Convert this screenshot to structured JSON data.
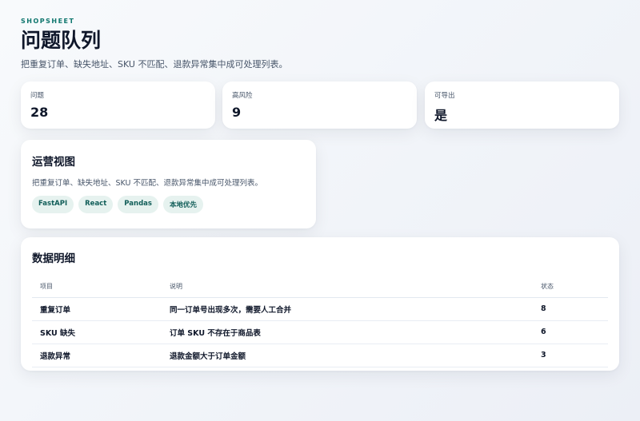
{
  "header": {
    "brand": "SHOPSHEET",
    "title": "问题队列",
    "subtitle": "把重复订单、缺失地址、SKU 不匹配、退款异常集中成可处理列表。"
  },
  "stats": [
    {
      "label": "问题",
      "value": "28"
    },
    {
      "label": "高风险",
      "value": "9"
    },
    {
      "label": "可导出",
      "value": "是"
    }
  ],
  "ops": {
    "title": "运营视图",
    "description": "把重复订单、缺失地址、SKU 不匹配、退款异常集中成可处理列表。",
    "tags": [
      "FastAPI",
      "React",
      "Pandas",
      "本地优先"
    ]
  },
  "table": {
    "title": "数据明细",
    "columns": [
      "项目",
      "说明",
      "状态"
    ],
    "rows": [
      [
        "重复订单",
        "同一订单号出现多次，需要人工合并",
        "8"
      ],
      [
        "SKU 缺失",
        "订单 SKU 不存在于商品表",
        "6"
      ],
      [
        "退款异常",
        "退款金额大于订单金额",
        "3"
      ]
    ]
  }
}
